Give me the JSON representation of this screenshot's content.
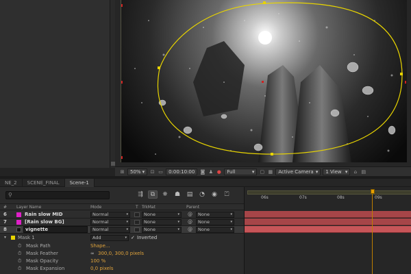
{
  "viewer": {
    "zoom": "50%",
    "timecode": "0:00:10:00",
    "resolution": "Full",
    "camera": "Active Camera",
    "views": "1 View"
  },
  "timeline": {
    "tabs": [
      "NE_2",
      "SCENE_FINAL",
      "Scene-1"
    ],
    "active_tab": "Scene-1",
    "search_placeholder": "⚲",
    "columns": {
      "num": "#",
      "layer_name": "Layer Name",
      "mode": "Mode",
      "t": "T",
      "trkmat": "TrkMat",
      "parent": "Parent"
    },
    "ruler_labels": [
      "06s",
      "07s",
      "08s",
      "09s"
    ],
    "layers": [
      {
        "num": "6",
        "name": "Rain slow MID",
        "color": "#e020c8",
        "mode": "Normal",
        "trkmat": "None",
        "parent": "None"
      },
      {
        "num": "7",
        "name": "[Rain slow BG]",
        "color": "#e020c8",
        "mode": "Normal",
        "trkmat": "None",
        "parent": "None"
      },
      {
        "num": "8",
        "name": "vignette",
        "color": "#111111",
        "mode": "Normal",
        "trkmat": "None",
        "parent": "None"
      }
    ],
    "mask": {
      "name": "Mask 1",
      "mode": "Add",
      "inverted_label": "Inverted",
      "props": [
        {
          "name": "Mask Path",
          "value": "Shape..."
        },
        {
          "name": "Mask Feather",
          "value": "300,0, 300,0 pixels"
        },
        {
          "name": "Mask Opacity",
          "value": "100 %"
        },
        {
          "name": "Mask Expansion",
          "value": "0,0 pixels"
        }
      ]
    }
  },
  "colors": {
    "mask_line": "#e8d400",
    "bar": "#a64548",
    "cti": "#e6a000",
    "value": "#e1a43c"
  }
}
